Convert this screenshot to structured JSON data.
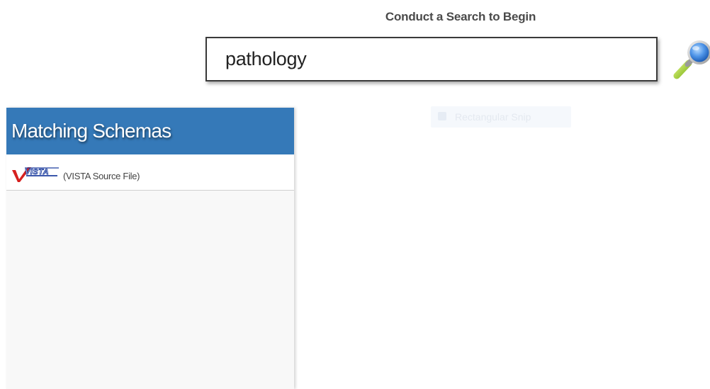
{
  "search": {
    "heading": "Conduct a Search to Begin",
    "query": "pathology",
    "button_icon": "magnifier-search-icon"
  },
  "results_panel": {
    "title": "Matching Schemas",
    "items": [
      {
        "logo_text": "VISTA",
        "logo_icon": "vista-logo-icon",
        "label": "(VISTA Source File)"
      }
    ]
  },
  "snip_overlay": {
    "label": "Rectangular Snip"
  },
  "colors": {
    "panel_header": "#3579b8",
    "vista_red": "#d6201f",
    "vista_blue": "#1f3f9f",
    "magnifier_lens": "#4f95e8",
    "magnifier_handle": "#9ccf2a"
  }
}
